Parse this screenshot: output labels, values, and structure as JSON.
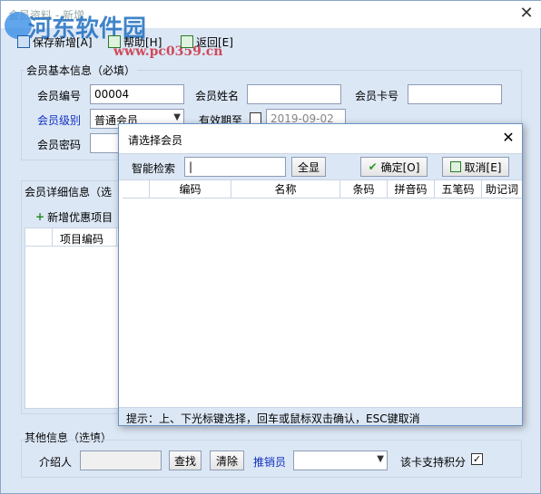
{
  "window": {
    "title": "会员资料 - 新增",
    "close_symbol": "✕"
  },
  "watermark": {
    "brand": "河东软件园",
    "url": "www.pc0359.cn"
  },
  "toolbar": {
    "save_label": "保存新增[A]",
    "help_label": "帮助[H]",
    "back_label": "返回[E]"
  },
  "basic": {
    "group_label": "会员基本信息（必填）",
    "member_no_label": "会员编号",
    "member_no_value": "00004",
    "member_name_label": "会员姓名",
    "card_no_label": "会员卡号",
    "level_label": "会员级别",
    "level_value": "普通会员",
    "expire_label": "有效期至",
    "expire_value": "2019-09-02",
    "password_label": "会员密码"
  },
  "detail": {
    "tab_label": "会员详细信息（选",
    "add_item_label": "新增优惠项目",
    "col_item_code": "项目编码"
  },
  "other": {
    "group_label": "其他信息（选填）",
    "referrer_label": "介绍人",
    "find_label": "查找",
    "clear_label": "清除",
    "seller_label": "推销员",
    "points_label": "该卡支持积分",
    "points_checked": "✓"
  },
  "dialog": {
    "title": "请选择会员",
    "close_symbol": "✕",
    "search_label": "智能检索",
    "show_all_label": "全显",
    "ok_label": "确定[O]",
    "cancel_label": "取消[E]",
    "columns": [
      "编码",
      "名称",
      "条码",
      "拼音码",
      "五笔码",
      "助记词"
    ],
    "status": "提示：上、下光标键选择，回车或鼠标双击确认，ESC键取消"
  },
  "colors": {
    "accent": "#1030c0",
    "panel": "#dce7f5"
  }
}
